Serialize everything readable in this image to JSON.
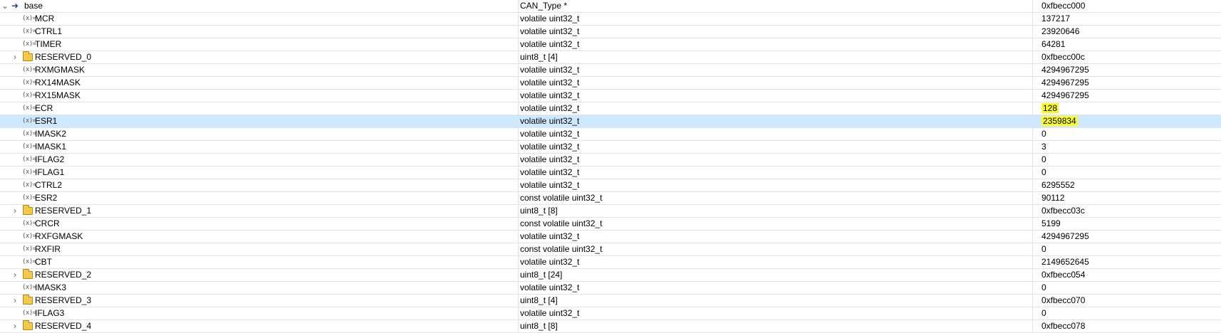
{
  "root": {
    "name": "base",
    "type": "CAN_Type *",
    "value": "0xfbecc000",
    "icon": "pointer-icon",
    "expanded": true
  },
  "rows": [
    {
      "name": "MCR",
      "type": "volatile uint32_t",
      "value": "137217",
      "kind": "var"
    },
    {
      "name": "CTRL1",
      "type": "volatile uint32_t",
      "value": "23920646",
      "kind": "var"
    },
    {
      "name": "TIMER",
      "type": "volatile uint32_t",
      "value": "64281",
      "kind": "var"
    },
    {
      "name": "RESERVED_0",
      "type": "uint8_t [4]",
      "value": "0xfbecc00c",
      "kind": "array"
    },
    {
      "name": "RXMGMASK",
      "type": "volatile uint32_t",
      "value": "4294967295",
      "kind": "var"
    },
    {
      "name": "RX14MASK",
      "type": "volatile uint32_t",
      "value": "4294967295",
      "kind": "var"
    },
    {
      "name": "RX15MASK",
      "type": "volatile uint32_t",
      "value": "4294967295",
      "kind": "var"
    },
    {
      "name": "ECR",
      "type": "volatile uint32_t",
      "value": "128",
      "kind": "var",
      "highlight": true
    },
    {
      "name": "ESR1",
      "type": "volatile uint32_t",
      "value": "2359834",
      "kind": "var",
      "highlight": true,
      "selected": true
    },
    {
      "name": "IMASK2",
      "type": "volatile uint32_t",
      "value": "0",
      "kind": "var"
    },
    {
      "name": "IMASK1",
      "type": "volatile uint32_t",
      "value": "3",
      "kind": "var"
    },
    {
      "name": "IFLAG2",
      "type": "volatile uint32_t",
      "value": "0",
      "kind": "var"
    },
    {
      "name": "IFLAG1",
      "type": "volatile uint32_t",
      "value": "0",
      "kind": "var"
    },
    {
      "name": "CTRL2",
      "type": "volatile uint32_t",
      "value": "6295552",
      "kind": "var"
    },
    {
      "name": "ESR2",
      "type": "const volatile uint32_t",
      "value": "90112",
      "kind": "var"
    },
    {
      "name": "RESERVED_1",
      "type": "uint8_t [8]",
      "value": "0xfbecc03c",
      "kind": "array"
    },
    {
      "name": "CRCR",
      "type": "const volatile uint32_t",
      "value": "5199",
      "kind": "var"
    },
    {
      "name": "RXFGMASK",
      "type": "volatile uint32_t",
      "value": "4294967295",
      "kind": "var"
    },
    {
      "name": "RXFIR",
      "type": "const volatile uint32_t",
      "value": "0",
      "kind": "var"
    },
    {
      "name": "CBT",
      "type": "volatile uint32_t",
      "value": "2149652645",
      "kind": "var"
    },
    {
      "name": "RESERVED_2",
      "type": "uint8_t [24]",
      "value": "0xfbecc054",
      "kind": "array"
    },
    {
      "name": "IMASK3",
      "type": "volatile uint32_t",
      "value": "0",
      "kind": "var"
    },
    {
      "name": "RESERVED_3",
      "type": "uint8_t [4]",
      "value": "0xfbecc070",
      "kind": "array"
    },
    {
      "name": "IFLAG3",
      "type": "volatile uint32_t",
      "value": "0",
      "kind": "var"
    },
    {
      "name": "RESERVED_4",
      "type": "uint8_t [8]",
      "value": "0xfbecc078",
      "kind": "array"
    }
  ],
  "icons": {
    "variable": "variable-icon",
    "array": "folder-icon",
    "expand": "chevron-right-icon",
    "collapse": "chevron-down-icon"
  },
  "colors": {
    "selection": "#cde8ff",
    "highlight": "#fbfb2a",
    "gridline": "#e3e3e3"
  },
  "symbols": {
    "var_glyph": "(x)=",
    "expand_glyph": "›",
    "collapse_glyph": "⌄",
    "pointer_glyph": "➜"
  }
}
